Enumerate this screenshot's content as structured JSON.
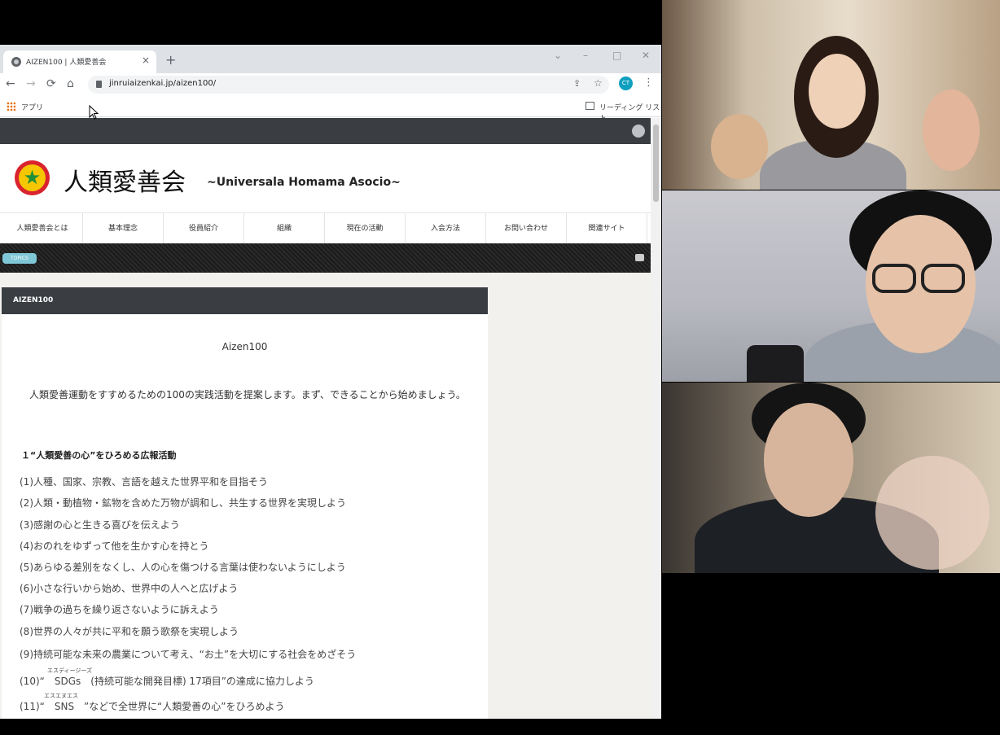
{
  "browser": {
    "tab_title": "AIZEN100 | 人類愛善会",
    "tab_close": "×",
    "new_tab": "+",
    "window_controls": [
      "⌄",
      "–",
      "□",
      "✕"
    ],
    "nav": {
      "back": "←",
      "forward": "→",
      "reload": "⟳",
      "home": "⌂"
    },
    "url": "jinruiaizenkai.jp/aizen100/",
    "profile_initials": "CT",
    "kebab": "⋮",
    "bookmarks": {
      "apps_label": "アプリ",
      "reading_list_label": "リーディング リスト"
    }
  },
  "site": {
    "logo_glyph": "★",
    "title": "人類愛善会",
    "subtitle": "~Universala Homama Asocio~",
    "nav": [
      "人類愛善会とは",
      "基本理念",
      "役員紹介",
      "組織",
      "現在の活動",
      "入会方法",
      "お問い合わせ",
      "関連サイト"
    ],
    "topics_label": "TOPICS"
  },
  "article": {
    "header": "AIZEN100",
    "title": "Aizen100",
    "intro": "人類愛善運動をすすめるための100の実践活動を提案します。まず、できることから始めましょう。",
    "section1": "１“人類愛善の心”をひろめる広報活動",
    "items": [
      "(1)人種、国家、宗教、言語を越えた世界平和を目指そう",
      "(2)人類・動植物・鉱物を含めた万物が調和し、共生する世界を実現しよう",
      "(3)感謝の心と生きる喜びを伝えよう",
      "(4)おのれをゆずって他を生かす心を持とう",
      "(5)あらゆる差別をなくし、人の心を傷つける言葉は使わないようにしよう",
      "(6)小さな行いから始め、世界中の人へと広げよう",
      "(7)戦争の過ちを繰り返さないように訴えよう",
      "(8)世界の人々が共に平和を願う歌祭を実現しよう",
      "(9)持続可能な未来の農業について考え、“お土”を大切にする社会をめざそう",
      "(10)“　SDGs　(持続可能な開発目標) 17項目”の達成に協力しよう",
      "(11)“　SNS　”などで全世界に“人類愛善の心”をひろめよう"
    ],
    "ruby": [
      "エスディージーズ",
      "エスエヌエス"
    ]
  },
  "colors": {
    "site_dark_bar": "#3a3d42",
    "logo_red": "#d9232e",
    "logo_yellow": "#f6c600",
    "logo_green": "#1f8f3a",
    "topics_badge": "#7fc6d6"
  }
}
